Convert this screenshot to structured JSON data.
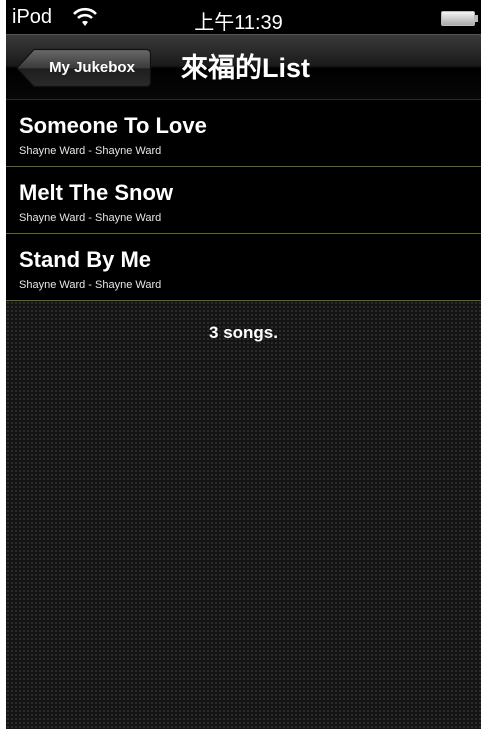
{
  "status_bar": {
    "carrier": "iPod",
    "time": "上午11:39",
    "wifi_icon": "wifi-icon",
    "battery_icon": "battery-icon"
  },
  "nav": {
    "back_label": "My Jukebox",
    "title": "來福的List"
  },
  "songs": [
    {
      "title": "Someone To Love",
      "subtitle": "Shayne Ward - Shayne Ward"
    },
    {
      "title": "Melt The Snow",
      "subtitle": "Shayne Ward - Shayne Ward"
    },
    {
      "title": "Stand By Me",
      "subtitle": "Shayne Ward - Shayne Ward"
    }
  ],
  "footer": {
    "count": "3 songs."
  },
  "colors": {
    "background": "#000000",
    "row_separator": "#5a6b1e",
    "text": "#ffffff"
  }
}
